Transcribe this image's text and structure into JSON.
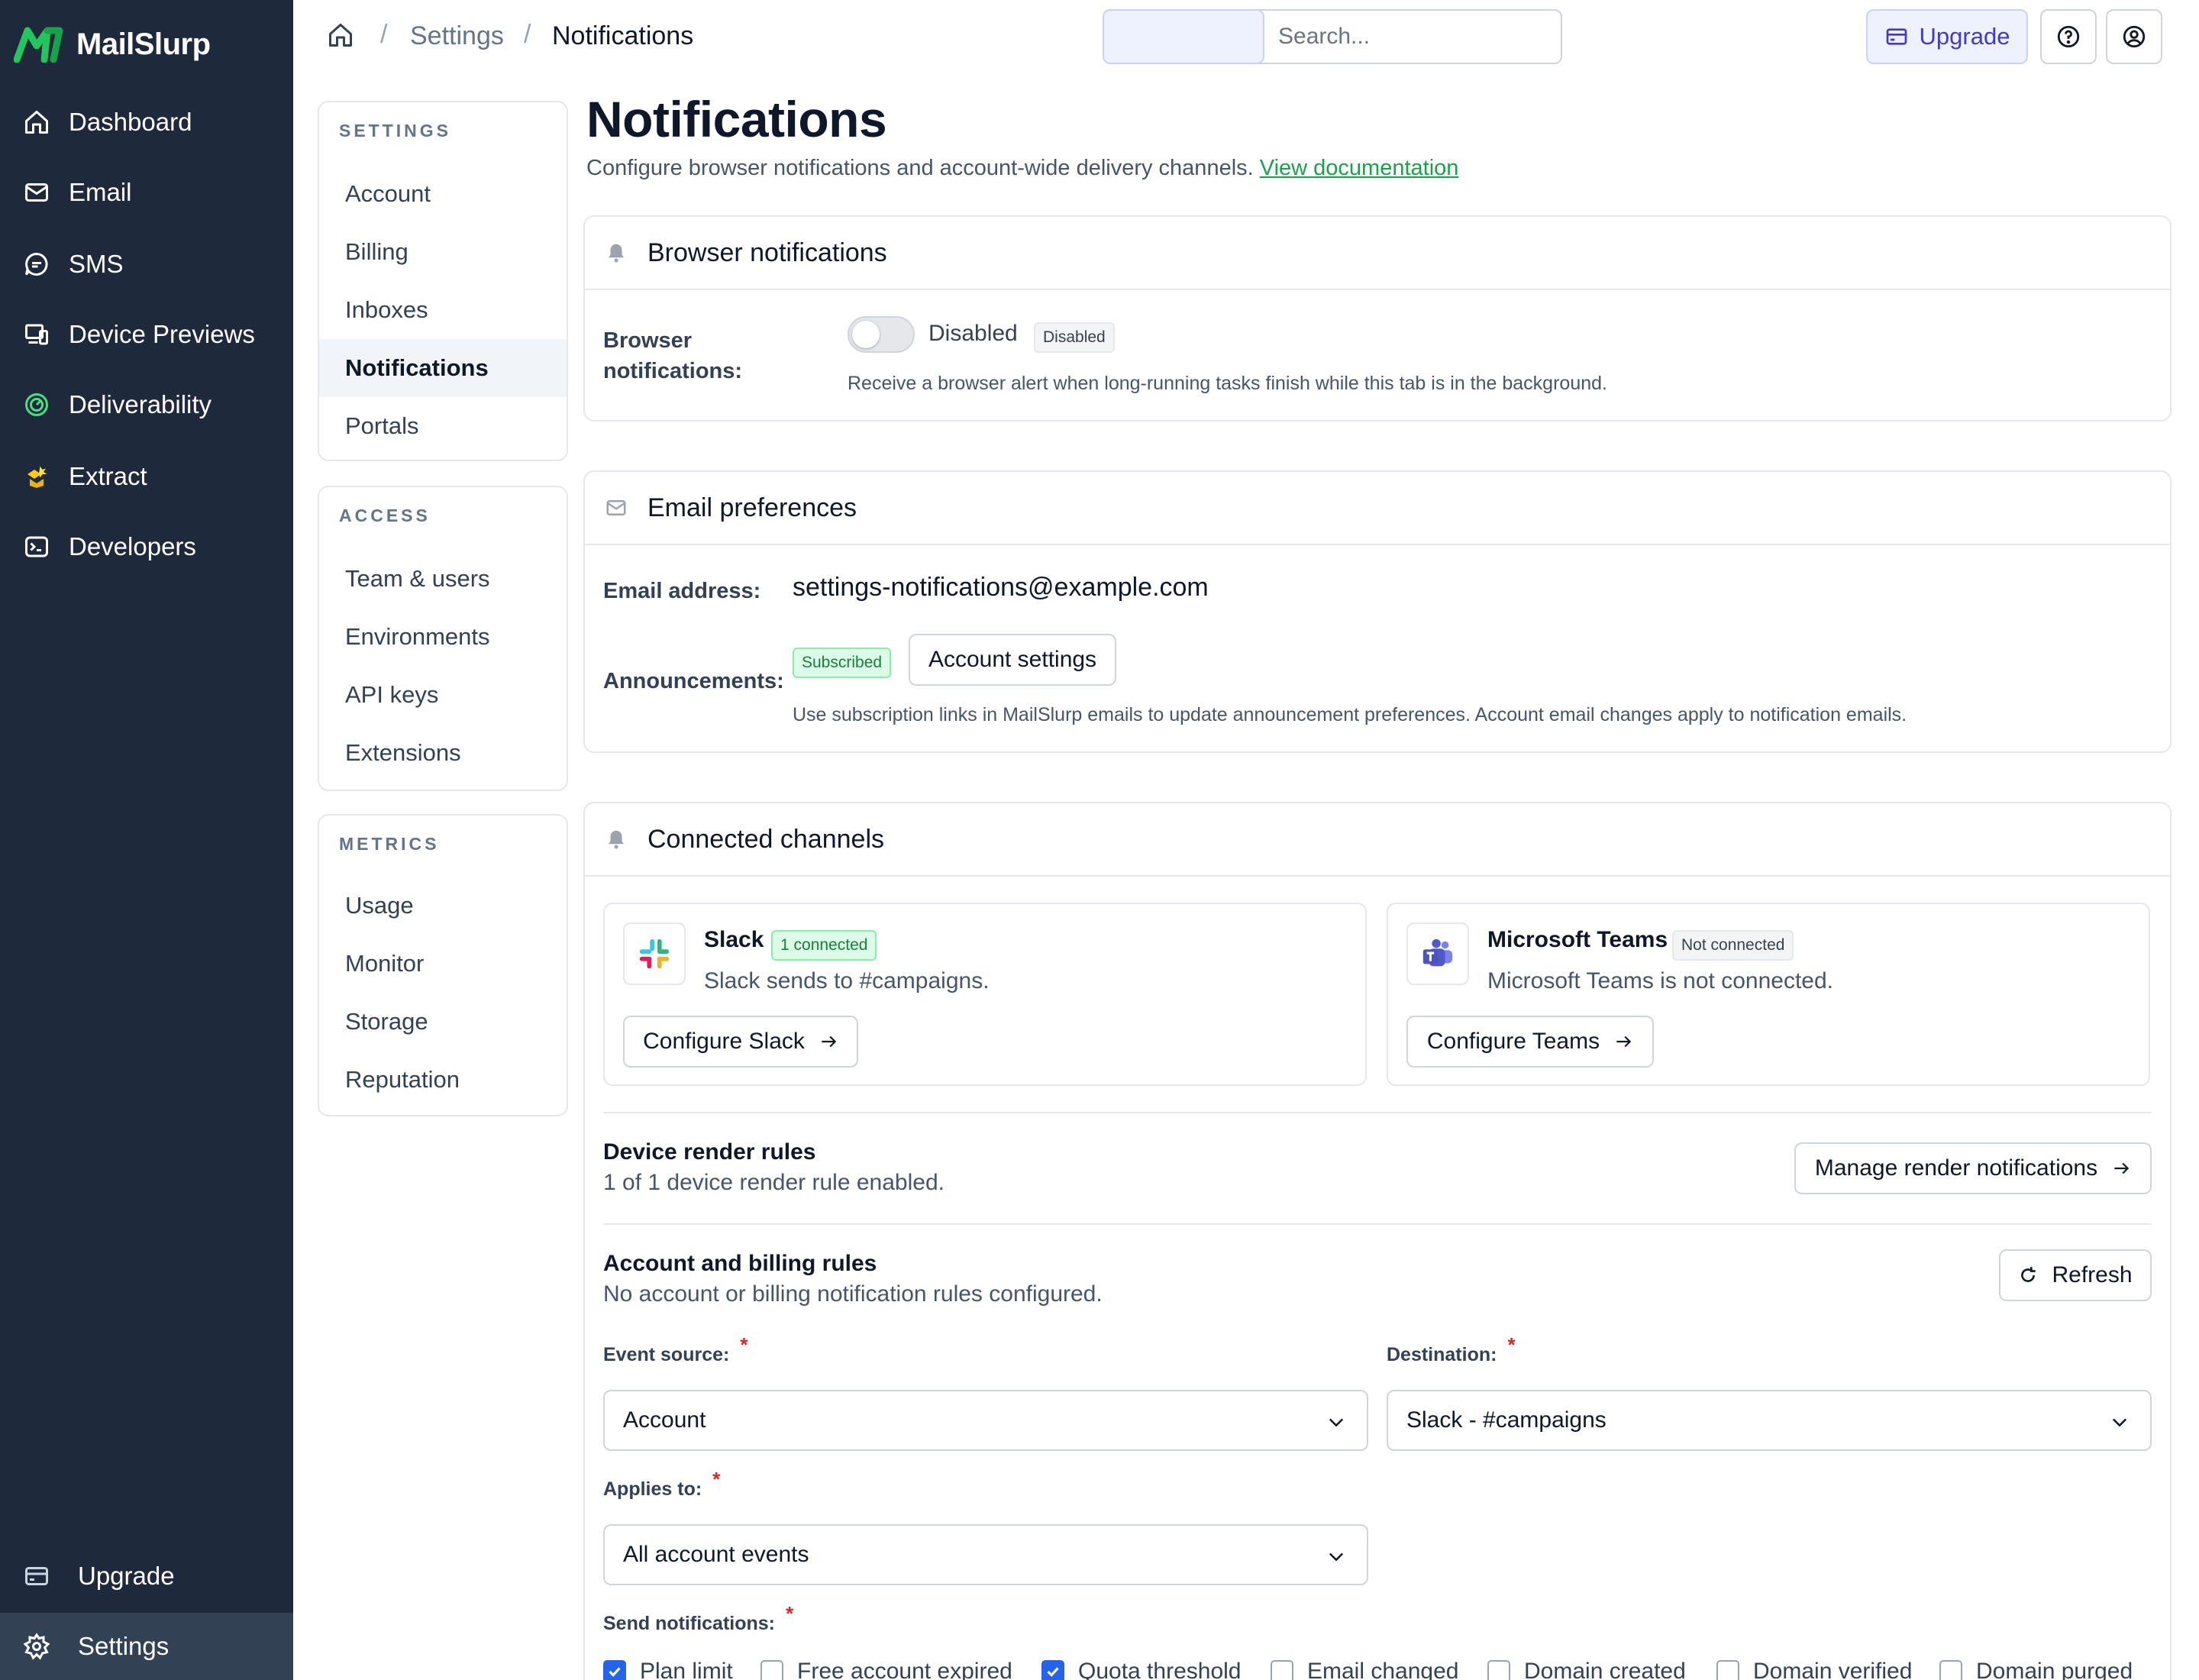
{
  "brand": {
    "name": "MailSlurp",
    "accent": "#16a34a"
  },
  "nav": {
    "items": [
      {
        "label": "Dashboard",
        "icon": "home-icon"
      },
      {
        "label": "Email",
        "icon": "mail-icon"
      },
      {
        "label": "SMS",
        "icon": "chat-icon"
      },
      {
        "label": "Device Previews",
        "icon": "devices-icon"
      },
      {
        "label": "Deliverability",
        "icon": "gauge-icon"
      },
      {
        "label": "Extract",
        "icon": "extract-icon"
      },
      {
        "label": "Developers",
        "icon": "terminal-icon"
      }
    ],
    "bottom": [
      {
        "label": "Upgrade",
        "icon": "credit-card-icon"
      },
      {
        "label": "Settings",
        "icon": "gear-icon"
      }
    ]
  },
  "header": {
    "breadcrumb": [
      "Settings",
      "Notifications"
    ],
    "breadcrumb_sep": "/",
    "search_placeholder": "Search...",
    "upgrade_label": "Upgrade"
  },
  "subnav": {
    "groups": [
      {
        "title": "SETTINGS",
        "items": [
          "Account",
          "Billing",
          "Inboxes",
          "Notifications",
          "Portals"
        ]
      },
      {
        "title": "ACCESS",
        "items": [
          "Team & users",
          "Environments",
          "API keys",
          "Extensions"
        ]
      },
      {
        "title": "METRICS",
        "items": [
          "Usage",
          "Monitor",
          "Storage",
          "Reputation"
        ]
      }
    ],
    "active": "Notifications"
  },
  "page": {
    "title": "Notifications",
    "subtitle": "Configure browser notifications and account-wide delivery channels.",
    "doc_link": "View documentation"
  },
  "browser": {
    "title": "Browser notifications",
    "label_line1": "Browser",
    "label_line2": "notifications:",
    "toggle_text": "Disabled",
    "badge": "Disabled",
    "help": "Receive a browser alert when long-running tasks finish while this tab is in the background."
  },
  "email_prefs": {
    "title": "Email preferences",
    "address_label": "Email address:",
    "address_value": "settings-notifications@example.com",
    "announcements_label": "Announcements:",
    "subscribed_badge": "Subscribed",
    "account_settings_button": "Account settings",
    "help": "Use subscription links in MailSlurp emails to update announcement preferences. Account email changes apply to notification emails."
  },
  "channels": {
    "title": "Connected channels",
    "slack": {
      "name": "Slack",
      "badge": "1 connected",
      "desc": "Slack sends to #campaigns.",
      "button": "Configure Slack"
    },
    "teams": {
      "name": "Microsoft Teams",
      "badge": "Not connected",
      "desc": "Microsoft Teams is not connected.",
      "button": "Configure Teams"
    },
    "render_rules": {
      "title": "Device render rules",
      "text": "1 of 1 device render rule enabled.",
      "button": "Manage render notifications"
    },
    "billing_rules": {
      "title": "Account and billing rules",
      "text": "No account or billing notification rules configured.",
      "refresh_button": "Refresh"
    },
    "form": {
      "event_source_label": "Event source:",
      "event_source_value": "Account",
      "destination_label": "Destination:",
      "destination_value": "Slack - #campaigns",
      "applies_to_label": "Applies to:",
      "applies_to_value": "All account events",
      "send_label": "Send notifications:",
      "required_mark": "*",
      "checkboxes": [
        {
          "label": "Plan limit",
          "checked": true
        },
        {
          "label": "Free account expired",
          "checked": false
        },
        {
          "label": "Quota threshold",
          "checked": true
        },
        {
          "label": "Email changed",
          "checked": false
        },
        {
          "label": "Domain created",
          "checked": false
        },
        {
          "label": "Domain verified",
          "checked": false
        },
        {
          "label": "Domain purged",
          "checked": false
        }
      ]
    }
  }
}
